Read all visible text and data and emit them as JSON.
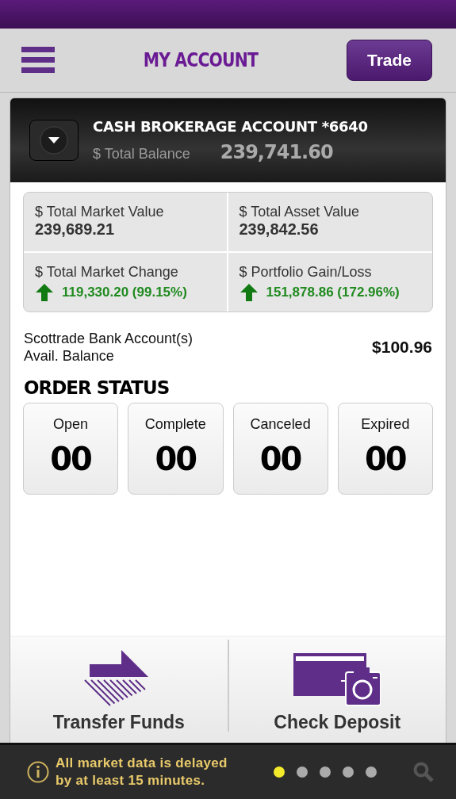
{
  "header": {
    "title": "MY ACCOUNT",
    "trade_button": "Trade"
  },
  "account": {
    "name": "CASH BROKERAGE ACCOUNT *6640",
    "balance_label": "$ Total Balance",
    "balance": "239,741.60"
  },
  "metrics": [
    {
      "label": "$ Total Market Value",
      "value": "239,689.21"
    },
    {
      "label": "$ Total Asset Value",
      "value": "239,842.56"
    },
    {
      "label": "$ Total Market Change",
      "value": "119,330.20 (99.15%)",
      "gain": true
    },
    {
      "label": "$ Portfolio Gain/Loss",
      "value": "151,878.86 (172.96%)",
      "gain": true
    }
  ],
  "bank": {
    "label_lines": [
      "Scottrade Bank Account(s)",
      "Avail. Balance"
    ],
    "amount": "$100.96"
  },
  "order_status": {
    "title": "ORDER STATUS",
    "tiles": [
      {
        "label": "Open",
        "count": "00"
      },
      {
        "label": "Complete",
        "count": "00"
      },
      {
        "label": "Canceled",
        "count": "00"
      },
      {
        "label": "Expired",
        "count": "00"
      }
    ]
  },
  "actions": [
    {
      "label": "Transfer Funds",
      "kind": "transfer"
    },
    {
      "label": "Check Deposit",
      "kind": "deposit"
    }
  ],
  "footer": {
    "notice_lines": [
      "All market data is delayed",
      "by at least 15 minutes."
    ],
    "pages": [
      {
        "selected": true
      },
      {
        "selected": false
      },
      {
        "selected": false
      },
      {
        "selected": false
      },
      {
        "selected": false
      }
    ]
  }
}
